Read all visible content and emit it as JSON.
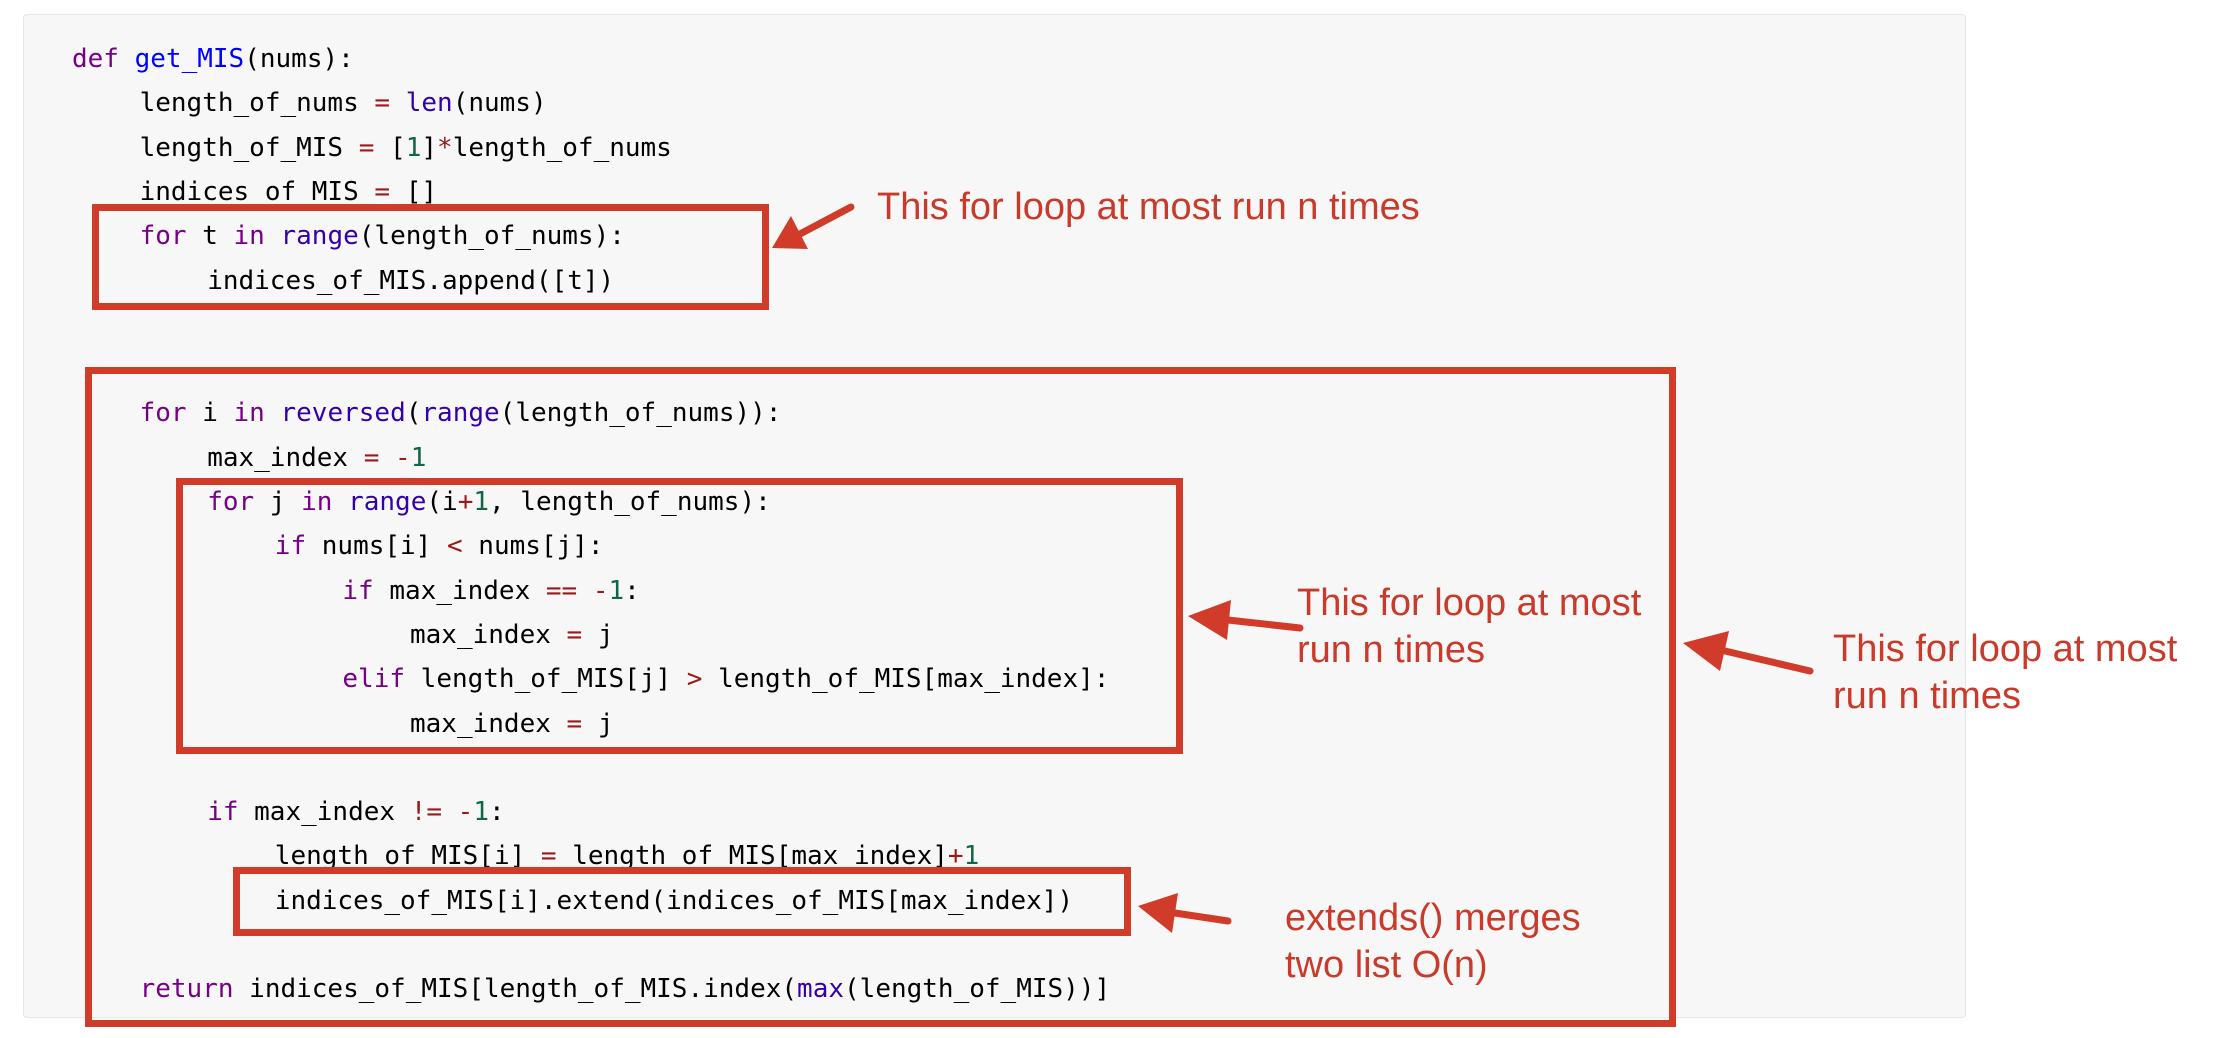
{
  "code": {
    "lines": [
      {
        "indent": 0,
        "tokens": [
          {
            "t": "def",
            "c": "kw"
          },
          {
            "t": " "
          },
          {
            "t": "get_MIS",
            "c": "fn"
          },
          {
            "t": "(nums):"
          }
        ]
      },
      {
        "indent": 1,
        "tokens": [
          {
            "t": "length_of_nums "
          },
          {
            "t": "=",
            "c": "op"
          },
          {
            "t": " "
          },
          {
            "t": "len",
            "c": "bi"
          },
          {
            "t": "(nums)"
          }
        ]
      },
      {
        "indent": 1,
        "tokens": [
          {
            "t": "length_of_MIS "
          },
          {
            "t": "=",
            "c": "op"
          },
          {
            "t": " ["
          },
          {
            "t": "1",
            "c": "num"
          },
          {
            "t": "]"
          },
          {
            "t": "*",
            "c": "op"
          },
          {
            "t": "length_of_nums"
          }
        ]
      },
      {
        "indent": 1,
        "tokens": [
          {
            "t": "indices_of_MIS "
          },
          {
            "t": "=",
            "c": "op"
          },
          {
            "t": " []"
          }
        ]
      },
      {
        "indent": 1,
        "tokens": [
          {
            "t": "for",
            "c": "kw"
          },
          {
            "t": " t "
          },
          {
            "t": "in",
            "c": "kw"
          },
          {
            "t": " "
          },
          {
            "t": "range",
            "c": "bi"
          },
          {
            "t": "(length_of_nums):"
          }
        ]
      },
      {
        "indent": 2,
        "tokens": [
          {
            "t": "indices_of_MIS.append([t])"
          }
        ]
      },
      {
        "indent": 0,
        "tokens": []
      },
      {
        "indent": 0,
        "tokens": []
      },
      {
        "indent": 1,
        "tokens": [
          {
            "t": "for",
            "c": "kw"
          },
          {
            "t": " i "
          },
          {
            "t": "in",
            "c": "kw"
          },
          {
            "t": " "
          },
          {
            "t": "reversed",
            "c": "bi"
          },
          {
            "t": "("
          },
          {
            "t": "range",
            "c": "bi"
          },
          {
            "t": "(length_of_nums)):"
          }
        ]
      },
      {
        "indent": 2,
        "tokens": [
          {
            "t": "max_index "
          },
          {
            "t": "=",
            "c": "op"
          },
          {
            "t": " "
          },
          {
            "t": "-",
            "c": "op"
          },
          {
            "t": "1",
            "c": "num"
          }
        ]
      },
      {
        "indent": 2,
        "tokens": [
          {
            "t": "for",
            "c": "kw"
          },
          {
            "t": " j "
          },
          {
            "t": "in",
            "c": "kw"
          },
          {
            "t": " "
          },
          {
            "t": "range",
            "c": "bi"
          },
          {
            "t": "(i"
          },
          {
            "t": "+",
            "c": "op"
          },
          {
            "t": "1",
            "c": "num"
          },
          {
            "t": ", length_of_nums):"
          }
        ]
      },
      {
        "indent": 3,
        "tokens": [
          {
            "t": "if",
            "c": "kw"
          },
          {
            "t": " nums[i] "
          },
          {
            "t": "<",
            "c": "op"
          },
          {
            "t": " nums[j]:"
          }
        ]
      },
      {
        "indent": 4,
        "tokens": [
          {
            "t": "if",
            "c": "kw"
          },
          {
            "t": " max_index "
          },
          {
            "t": "==",
            "c": "op"
          },
          {
            "t": " "
          },
          {
            "t": "-",
            "c": "op"
          },
          {
            "t": "1",
            "c": "num"
          },
          {
            "t": ":"
          }
        ]
      },
      {
        "indent": 5,
        "tokens": [
          {
            "t": "max_index "
          },
          {
            "t": "=",
            "c": "op"
          },
          {
            "t": " j"
          }
        ]
      },
      {
        "indent": 4,
        "tokens": [
          {
            "t": "elif",
            "c": "kw"
          },
          {
            "t": " length_of_MIS[j] "
          },
          {
            "t": ">",
            "c": "op"
          },
          {
            "t": " length_of_MIS[max_index]:"
          }
        ]
      },
      {
        "indent": 5,
        "tokens": [
          {
            "t": "max_index "
          },
          {
            "t": "=",
            "c": "op"
          },
          {
            "t": " j"
          }
        ]
      },
      {
        "indent": 0,
        "tokens": []
      },
      {
        "indent": 2,
        "tokens": [
          {
            "t": "if",
            "c": "kw"
          },
          {
            "t": " max_index "
          },
          {
            "t": "!=",
            "c": "op"
          },
          {
            "t": " "
          },
          {
            "t": "-",
            "c": "op"
          },
          {
            "t": "1",
            "c": "num"
          },
          {
            "t": ":"
          }
        ]
      },
      {
        "indent": 3,
        "tokens": [
          {
            "t": "length_of_MIS[i] "
          },
          {
            "t": "=",
            "c": "op"
          },
          {
            "t": " length_of_MIS[max_index]"
          },
          {
            "t": "+",
            "c": "op"
          },
          {
            "t": "1",
            "c": "num"
          }
        ]
      },
      {
        "indent": 3,
        "tokens": [
          {
            "t": "indices_of_MIS[i].extend(indices_of_MIS[max_index])"
          }
        ]
      },
      {
        "indent": 0,
        "tokens": []
      },
      {
        "indent": 1,
        "tokens": [
          {
            "t": "return",
            "c": "kw"
          },
          {
            "t": " indices_of_MIS[length_of_MIS.index("
          },
          {
            "t": "max",
            "c": "bi"
          },
          {
            "t": "(length_of_MIS))]"
          }
        ]
      }
    ]
  },
  "annotations": {
    "first_loop": {
      "lines": [
        "This for loop at most run n times"
      ]
    },
    "inner_loop": {
      "lines": [
        "This for loop at most",
        "run n times"
      ]
    },
    "outer_loop": {
      "lines": [
        "This for loop at most",
        "run n times"
      ]
    },
    "extend_note": {
      "lines": [
        "extends() merges",
        "two list O(n)"
      ]
    }
  },
  "colors": {
    "annotation": "#c93a2b",
    "box": "#d03b2a",
    "keyword": "#770088",
    "function": "#0000ff",
    "builtin": "#3300aa",
    "number": "#116644",
    "operator": "#981a1a",
    "panel_bg": "#f7f7f7"
  }
}
